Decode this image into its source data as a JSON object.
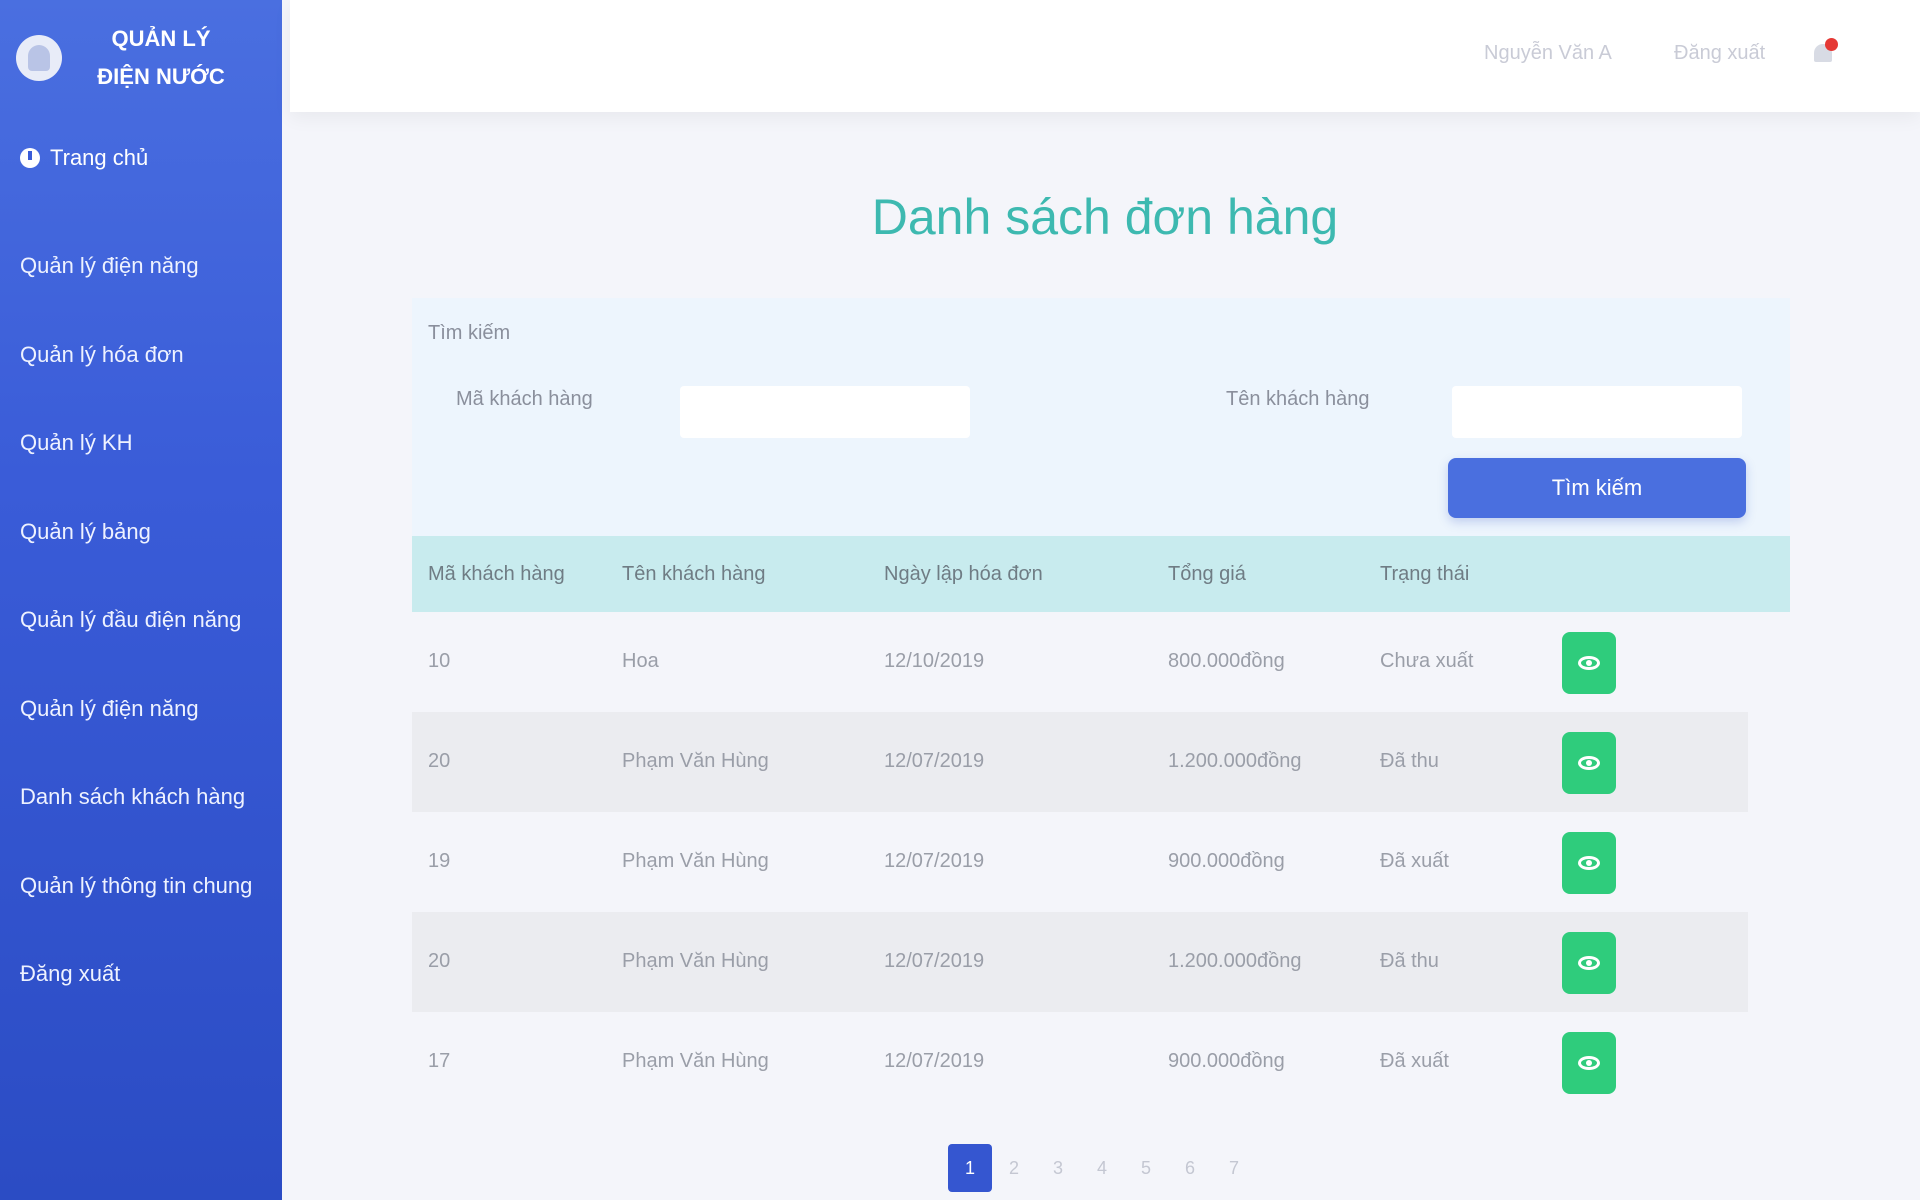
{
  "app": {
    "name": "QUẢN LÝ ĐIỆN NƯỚC"
  },
  "sidebar": {
    "dashboard_label": "Trang chủ",
    "items": [
      {
        "label": "Quản lý điện năng"
      },
      {
        "label": "Quản lý hóa đơn"
      },
      {
        "label": "Quản lý KH"
      },
      {
        "label": "Quản lý bảng"
      },
      {
        "label": "Quản lý đầu điện năng"
      },
      {
        "label": "Quản lý điện năng"
      },
      {
        "label": "Danh sách khách hàng"
      },
      {
        "label": "Quản lý thông tin chung"
      },
      {
        "label": "Đăng xuất"
      }
    ]
  },
  "header": {
    "user_label": "Nguyễn Văn A",
    "logout_label": "Đăng xuất"
  },
  "main": {
    "title": "Danh sách đơn hàng"
  },
  "search": {
    "heading": "Tìm kiếm",
    "code_label": "Mã khách hàng",
    "name_label": "Tên khách hàng",
    "code_value": "",
    "name_value": "",
    "button_label": "Tìm kiếm"
  },
  "table": {
    "headers": [
      "Mã khách hàng",
      "Tên khách hàng",
      "Ngày lập hóa đơn",
      "Tổng giá",
      "Trạng thái"
    ],
    "rows": [
      {
        "code": "10",
        "name": "Hoa",
        "date": "12/10/2019",
        "total": "800.000đồng",
        "status": "Chưa xuất"
      },
      {
        "code": "20",
        "name": "Phạm Văn Hùng",
        "date": "12/07/2019",
        "total": "1.200.000đồng",
        "status": "Đã thu"
      },
      {
        "code": "19",
        "name": "Phạm Văn Hùng",
        "date": "12/07/2019",
        "total": "900.000đồng",
        "status": "Đã xuất"
      },
      {
        "code": "20",
        "name": "Phạm Văn Hùng",
        "date": "12/07/2019",
        "total": "1.200.000đồng",
        "status": "Đã thu"
      },
      {
        "code": "17",
        "name": "Phạm Văn Hùng",
        "date": "12/07/2019",
        "total": "900.000đồng",
        "status": "Đã xuất"
      }
    ]
  },
  "pagination": {
    "pages": [
      "1",
      "2",
      "3",
      "4",
      "5",
      "6",
      "7"
    ],
    "current": "1"
  },
  "colors": {
    "sidebar": "#3a5cd8",
    "accent": "#4a6fdf",
    "title": "#3db9b0",
    "view_button": "#2fcc7c",
    "table_header": "#c8ebee",
    "notification": "#e53935"
  }
}
